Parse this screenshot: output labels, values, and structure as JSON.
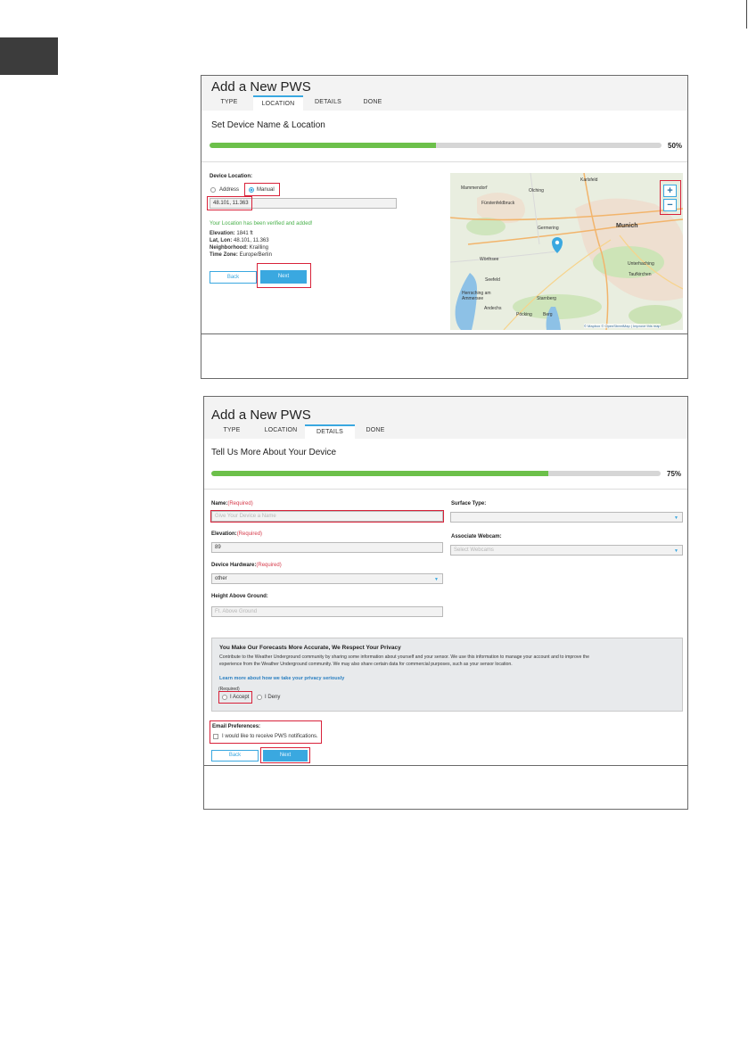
{
  "colors": {
    "accent": "#3aa8e0",
    "progress": "#6cc04a",
    "required": "#d63b4b",
    "highlight": "#d8223a",
    "verified": "#48b04a"
  },
  "screenshot1": {
    "title": "Add a New PWS",
    "tabs": [
      "TYPE",
      "LOCATION",
      "DETAILS",
      "DONE"
    ],
    "active_tab": "LOCATION",
    "subtitle": "Set Device Name & Location",
    "progress": {
      "value": 0.5,
      "label": "50%"
    },
    "device_location_label": "Device Location:",
    "radio_address": "Address",
    "radio_manual": "Manual",
    "coords_value": "48.101, 11.363",
    "verified_msg": "Your Location has been verified and added!",
    "info": [
      {
        "key": "Elevation:",
        "val": "1841 ft"
      },
      {
        "key": "Lat, Lon:",
        "val": "48.101, 11.363"
      },
      {
        "key": "Neighborhood:",
        "val": "Krailling"
      },
      {
        "key": "Time Zone:",
        "val": "Europe/Berlin"
      }
    ],
    "back_label": "Back",
    "next_label": "Next",
    "map": {
      "places": [
        "Karlsfeld",
        "Mammendorf",
        "Olching",
        "Fürstenfeldbruck",
        "Germering",
        "Munich",
        "Wörthsee",
        "Seefeld",
        "Unterhaching",
        "Taufkirchen",
        "Herrsching am Ammersee",
        "Starnberg",
        "Andechs",
        "Pöcking",
        "Berg"
      ],
      "zoom_in": "+",
      "zoom_out": "−",
      "attribution": "© Mapbox © OpenStreetMap | Improve this map"
    }
  },
  "screenshot2": {
    "title": "Add a New PWS",
    "tabs": [
      "TYPE",
      "LOCATION",
      "DETAILS",
      "DONE"
    ],
    "active_tab": "DETAILS",
    "subtitle": "Tell Us More About Your Device",
    "progress": {
      "value": 0.75,
      "label": "75%"
    },
    "name_label": "Name:",
    "required": "(Required)",
    "name_placeholder": "Give Your Device a Name",
    "elevation_label": "Elevation:",
    "elevation_value": "89",
    "hardware_label": "Device Hardware:",
    "hardware_value": "other",
    "height_label": "Height Above Ground:",
    "height_placeholder": "Ft. Above Ground",
    "surface_label": "Surface Type:",
    "surface_value": "",
    "webcam_label": "Associate Webcam:",
    "webcam_placeholder": "Select Webcams",
    "privacy_title": "You Make Our Forecasts More Accurate, We Respect Your Privacy",
    "privacy_body_1": "Contribute to the Weather Underground community by sharing some information about yourself and your sensor. We use this information to manage your account and to improve the",
    "privacy_body_2": "experience from the Weather Underground community. We may also share certain data for commercial purposes, such as your sensor location.",
    "privacy_link": "Learn more about how we take your privacy seriously",
    "required_small": "(Required)",
    "accept_label": "I Accept",
    "deny_label": "I Deny",
    "email_label": "Email Preferences:",
    "email_checkbox": "I would like to receive PWS notifications.",
    "back_label": "Back",
    "next_label": "Next"
  }
}
